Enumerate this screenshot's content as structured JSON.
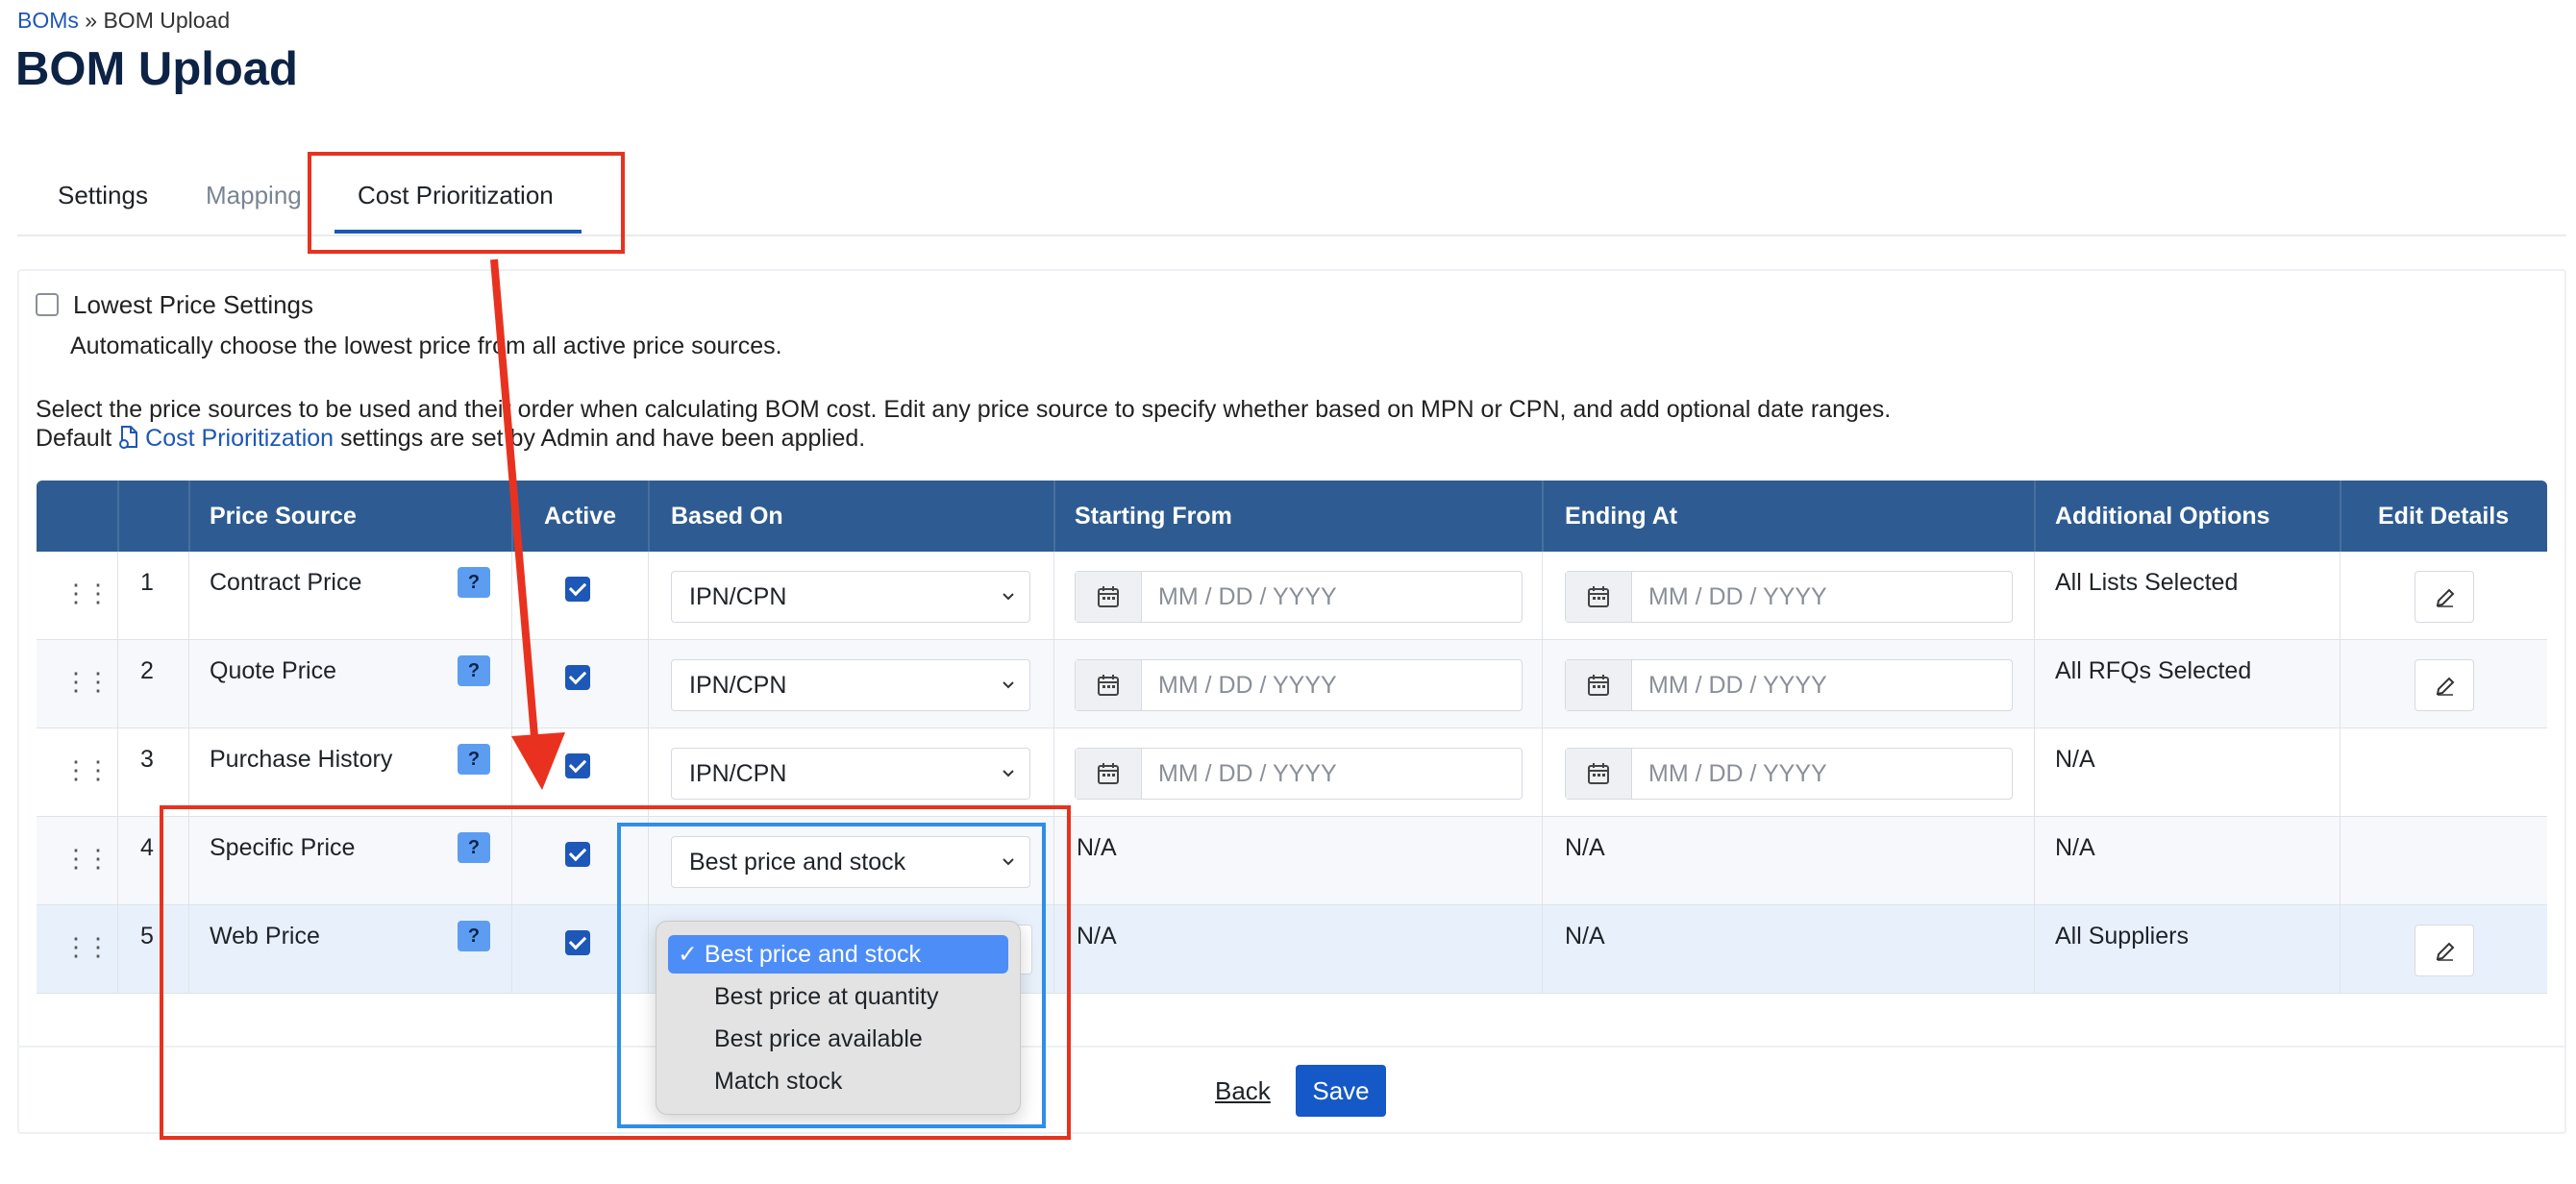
{
  "breadcrumb": {
    "parent": "BOMs",
    "separator": "»",
    "current": "BOM Upload"
  },
  "page": {
    "title": "BOM Upload"
  },
  "tabs": [
    {
      "label": "Settings"
    },
    {
      "label": "Mapping"
    },
    {
      "label": "Cost Prioritization"
    }
  ],
  "lowest_price": {
    "label": "Lowest Price Settings",
    "description": "Automatically choose the lowest price from all active price sources.",
    "checked": false
  },
  "intro": {
    "line1": "Select the price sources to be used and their order when calculating BOM cost. Edit any price source to specify whether based on MPN or CPN, and add optional date ranges.",
    "line2_prefix": "Default",
    "line2_link": "Cost Prioritization",
    "line2_suffix": "settings are set by Admin and have been applied."
  },
  "table": {
    "headers": {
      "price_source": "Price Source",
      "active": "Active",
      "based_on": "Based On",
      "starting_from": "Starting From",
      "ending_at": "Ending At",
      "additional_options": "Additional Options",
      "edit_details": "Edit Details"
    },
    "help_badge": "?",
    "date_placeholder": "MM / DD / YYYY",
    "rows": [
      {
        "num": "1",
        "source": "Contract Price",
        "based_on": "IPN/CPN",
        "start": "",
        "end": "",
        "options": "All Lists Selected"
      },
      {
        "num": "2",
        "source": "Quote Price",
        "based_on": "IPN/CPN",
        "start": "",
        "end": "",
        "options": "All RFQs Selected"
      },
      {
        "num": "3",
        "source": "Purchase History",
        "based_on": "IPN/CPN",
        "start": "",
        "end": "",
        "options": "N/A"
      },
      {
        "num": "4",
        "source": "Specific Price",
        "based_on": "Best price and stock",
        "start": "N/A",
        "end": "N/A",
        "options": "N/A"
      },
      {
        "num": "5",
        "source": "Web Price",
        "based_on": "",
        "start": "N/A",
        "end": "N/A",
        "options": "All Suppliers"
      }
    ]
  },
  "dropdown": {
    "options": [
      {
        "label": "Best price and stock",
        "selected": true
      },
      {
        "label": "Best price at quantity",
        "selected": false
      },
      {
        "label": "Best price available",
        "selected": false
      },
      {
        "label": "Match stock",
        "selected": false
      }
    ]
  },
  "footer": {
    "back": "Back",
    "save": "Save"
  },
  "colors": {
    "header_bg": "#2e5c92",
    "accent": "#1d57b8",
    "annotation_red": "#e8321f",
    "annotation_blue": "#2f8ee8"
  }
}
